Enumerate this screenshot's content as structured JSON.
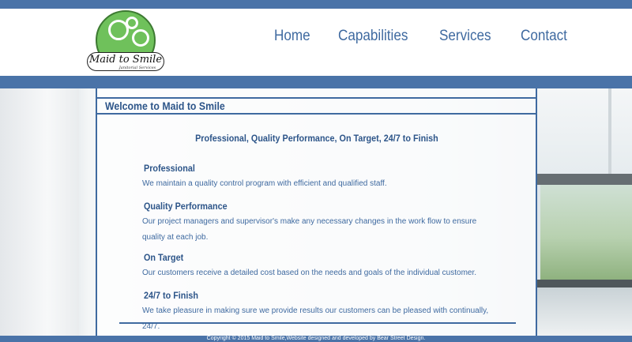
{
  "logo": {
    "title": "Maid to Smile",
    "subtitle": "Janitorial Services"
  },
  "nav": {
    "items": [
      "Home",
      "Capabilities",
      "Services",
      "Contact"
    ]
  },
  "content": {
    "title": "Welcome to Maid to Smile",
    "tagline": "Professional, Quality Performance, On Target, 24/7 to Finish",
    "sections": [
      {
        "heading": "Professional",
        "body": "We maintain a quality control program with efficient and qualified staff."
      },
      {
        "heading": "Quality Performance",
        "body": "Our project managers and supervisor's make any necessary changes in the work flow to ensure quality at each job."
      },
      {
        "heading": "On Target",
        "body": "Our customers receive a detailed cost based on the needs and goals of the individual customer."
      },
      {
        "heading": "24/7 to Finish",
        "body": "We take pleasure in making sure we provide results our customers can be pleased with continually, 24/7."
      }
    ]
  },
  "footer": {
    "text": "Copyright © 2015 Maid to Smile,Website designed and developed by Bear Street Design."
  },
  "colors": {
    "brand_blue": "#4a73a8",
    "heading_blue": "#2d5589",
    "logo_green": "#6fc15b"
  }
}
